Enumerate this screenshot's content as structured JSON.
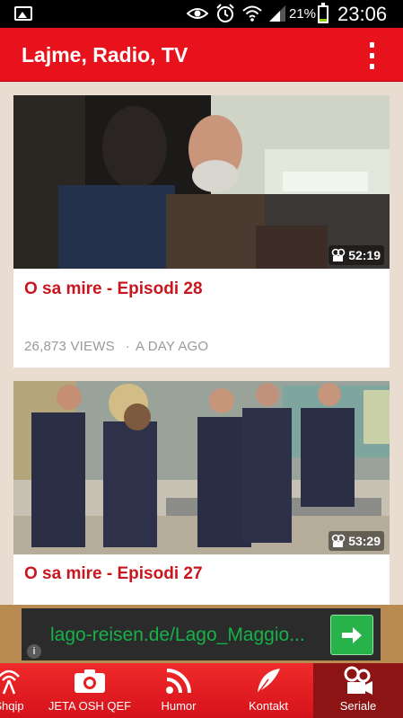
{
  "status_bar": {
    "battery_percent": "21%",
    "battery_level": 0.21,
    "time": "23:06",
    "icons": [
      "image-icon",
      "eye-icon",
      "alarm-icon",
      "wifi-icon",
      "signal-icon",
      "battery-icon"
    ]
  },
  "app_bar": {
    "title": "Lajme, Radio, TV",
    "menu_icon": "overflow-menu-icon"
  },
  "videos": [
    {
      "title": "O sa mire - Episodi 28",
      "duration": "52:19",
      "views": "26,873 VIEWS",
      "separator": "·",
      "age": "A DAY AGO"
    },
    {
      "title": "O sa mire - Episodi 27",
      "duration": "53:29"
    }
  ],
  "ad": {
    "text": "lago-reisen.de/Lago_Maggio...",
    "info_label": "i"
  },
  "bottom_nav": {
    "items": [
      {
        "label": "Shqip",
        "icon": "broadcast-icon",
        "active": false
      },
      {
        "label": "JETA OSH QEF",
        "icon": "camera-icon",
        "active": false
      },
      {
        "label": "Humor",
        "icon": "rss-icon",
        "active": false
      },
      {
        "label": "Kontakt",
        "icon": "feather-icon",
        "active": false
      },
      {
        "label": "Seriale",
        "icon": "film-camera-icon",
        "active": true
      }
    ]
  },
  "colors": {
    "accent": "#e8121c",
    "title_red": "#c8161f",
    "ad_green": "#15b24a"
  }
}
